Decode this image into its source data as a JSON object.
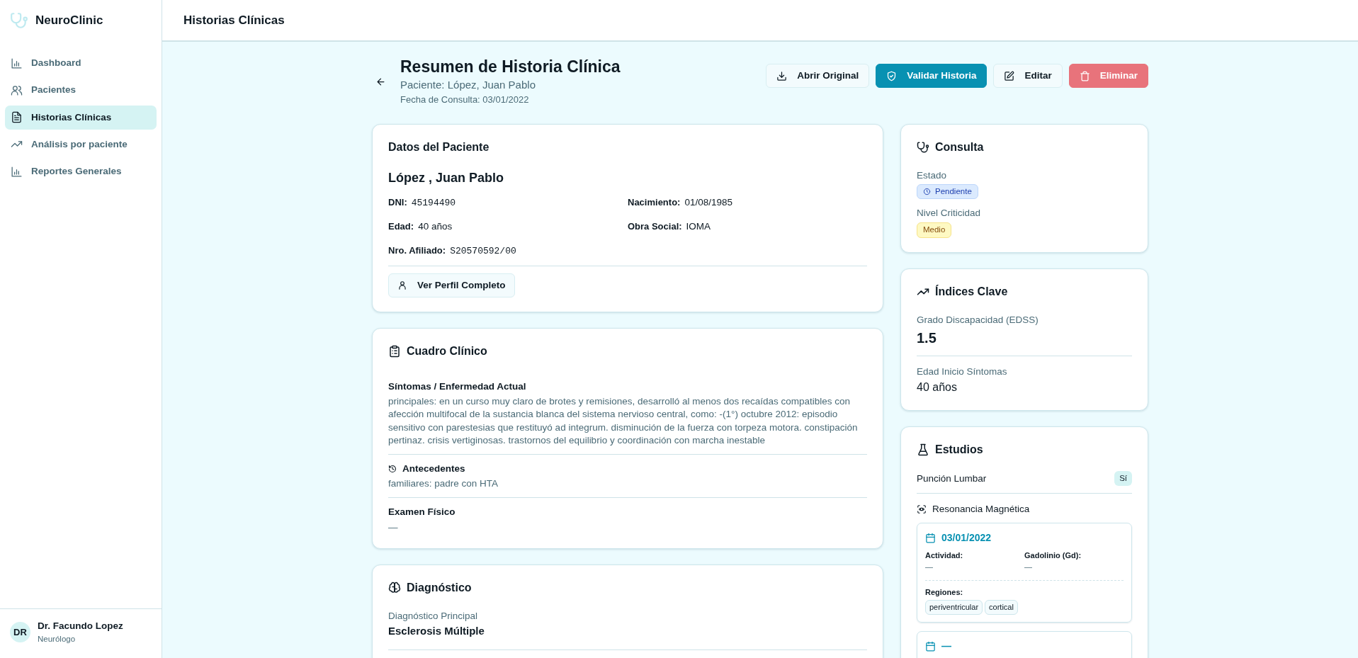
{
  "app": {
    "name": "NeuroClinic"
  },
  "sidebar": {
    "items": [
      {
        "label": "Dashboard",
        "selected": false
      },
      {
        "label": "Pacientes",
        "selected": false
      },
      {
        "label": "Historias Clínicas",
        "selected": true
      },
      {
        "label": "Análisis por paciente",
        "selected": false
      },
      {
        "label": "Reportes Generales",
        "selected": false
      }
    ]
  },
  "user": {
    "initials": "DR",
    "name": "Dr. Facundo Lopez",
    "role": "Neurólogo"
  },
  "header": {
    "title": "Historias Clínicas"
  },
  "summary": {
    "title": "Resumen de Historia Clínica",
    "patient": "Paciente: López, Juan Pablo",
    "date": "Fecha de Consulta: 03/01/2022"
  },
  "actions": [
    {
      "label": "Abrir Original",
      "kind": "outline"
    },
    {
      "label": "Validar Historia",
      "kind": "primary"
    },
    {
      "label": "Editar",
      "kind": "outline"
    },
    {
      "label": "Eliminar",
      "kind": "danger"
    }
  ],
  "patient_card": {
    "title": "Datos del Paciente",
    "name": "López , Juan Pablo",
    "fields": [
      {
        "label": "DNI:",
        "value": "45194490",
        "kind": "mono"
      },
      {
        "label": "Nacimiento:",
        "value": "01/08/1985",
        "kind": "text"
      },
      {
        "label": "Edad:",
        "value": "40 años",
        "kind": "text"
      },
      {
        "label": "Obra Social:",
        "value": "IOMA",
        "kind": "text"
      },
      {
        "label": "Nro. Afiliado:",
        "value": "S20570592/00",
        "kind": "mono"
      }
    ],
    "button": "Ver Perfil Completo"
  },
  "clinical": {
    "title": "Cuadro Clínico",
    "sections": [
      {
        "title": "Síntomas / Enfermedad Actual",
        "text": "principales: en un curso muy claro de brotes y remisiones, desarrolló al menos dos recaídas compatibles con afección multifocal de la sustancia blanca del sistema nervioso central, como: -(1°) octubre 2012: episodio sensitivo con parestesias que restituyó ad integrum. disminución de la fuerza con torpeza motora. constipación pertinaz. crisis vertiginosas. trastornos del equilibrio y coordinación con marcha inestable",
        "kind": "plain"
      },
      {
        "title": "Antecedentes",
        "text": "familiares: padre con HTA",
        "kind": "history"
      },
      {
        "title": "Examen Físico",
        "text": "—",
        "kind": "plain"
      }
    ]
  },
  "diagnosis": {
    "title": "Diagnóstico",
    "label": "Diagnóstico Principal",
    "value": "Esclerosis Múltiple"
  },
  "consulta": {
    "title": "Consulta",
    "status_label": "Estado",
    "status": "Pendiente",
    "level_label": "Nivel Criticidad",
    "level_badge": "Medio"
  },
  "indices": {
    "title": "Índices Clave",
    "items": [
      {
        "label": "Grado Discapacidad (EDSS)",
        "value": "1.5",
        "kind": "large"
      },
      {
        "label": "Edad Inicio Síntomas",
        "value": "40 años",
        "kind": "normal"
      }
    ]
  },
  "studies": {
    "title": "Estudios",
    "lumbar": {
      "label": "Punción Lumbar",
      "value": "Sí"
    },
    "mri": {
      "title": "Resonancia Magnética",
      "scans": [
        {
          "date": "03/01/2022",
          "fields": [
            {
              "label": "Actividad:",
              "value": "—"
            },
            {
              "label": "Gadolinio (Gd):",
              "value": "—"
            }
          ],
          "regions_label": "Regiones:",
          "regions": [
            "periventricular",
            "cortical"
          ]
        },
        {
          "date": "—"
        }
      ]
    }
  }
}
